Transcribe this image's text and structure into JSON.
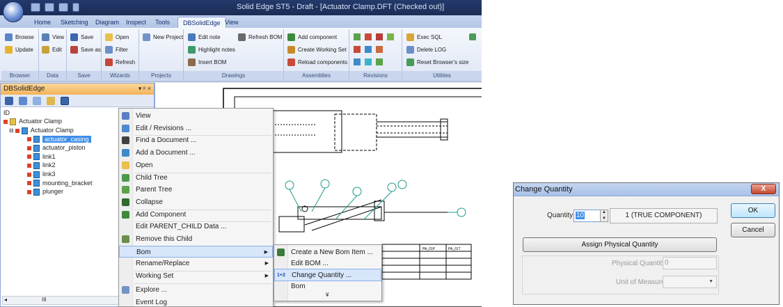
{
  "app": {
    "title": "Solid Edge ST5 - Draft - [Actuator Clamp.DFT (Checked out)]",
    "tabs": [
      "Home",
      "Sketching",
      "Diagram",
      "Inspect",
      "Tools",
      "DBSolidEdge",
      "View"
    ],
    "active_tab": "DBSolidEdge"
  },
  "ribbon": {
    "groups": {
      "browser": {
        "label": "Browser",
        "items": [
          "Browse",
          "Update"
        ]
      },
      "data": {
        "label": "Data",
        "items": [
          "View",
          "Edit"
        ]
      },
      "save": {
        "label": "Save",
        "items": [
          "Save",
          "Save as"
        ]
      },
      "wizards": {
        "label": "Wizards",
        "items": [
          "Open",
          "Filter",
          "Refresh"
        ]
      },
      "projects": {
        "label": "Projects",
        "items": [
          "New Project"
        ]
      },
      "drawings": {
        "label": "Drawings",
        "items": [
          "Edit note",
          "Highlight notes",
          "Insert BOM",
          "Refresh BOM"
        ]
      },
      "assemblies": {
        "label": "Assemblies",
        "items": [
          "Add component",
          "Create Working Set",
          "Reload components"
        ]
      },
      "revisions": {
        "label": "Revisions"
      },
      "utilities": {
        "label": "Utilities",
        "items": [
          "Exec SQL",
          "Delete LOG",
          "Reset Browser's size"
        ]
      }
    }
  },
  "panel": {
    "title": "DBSolidEdge",
    "controls": "▾ ᵖ ×",
    "column_header": "ID",
    "tree": {
      "root": "Actuator Clamp",
      "assembly": "Actuator Clamp",
      "children": [
        "actuator_casing",
        "actuator_piston",
        "link1",
        "link2",
        "link3",
        "mounting_bracket",
        "plunger"
      ],
      "selected": "actuator_casing"
    },
    "scroll_label": "III"
  },
  "context_menu": {
    "items": [
      "View",
      "Edit / Revisions ...",
      "Find a Document ...",
      "Add a Document ...",
      "Open",
      "Child Tree",
      "Parent Tree",
      "Collapse",
      "Add Component",
      "Edit PARENT_CHILD Data ...",
      "Remove this Child",
      "Bom",
      "Rename/Replace",
      "Working Set",
      "Explore ...",
      "Event Log"
    ],
    "highlighted": "Bom"
  },
  "submenu": {
    "items": [
      "Create a New Bom Item ...",
      "Edit BOM ...",
      "Change Quantity ...",
      "Bom"
    ],
    "highlighted": "Change Quantity ...",
    "more": "¥",
    "change_qty_icon": "1+2"
  },
  "drawing": {
    "table_headers": [
      "PA_01P",
      "PA_01T"
    ]
  },
  "dialog": {
    "title": "Change Quantity",
    "close_label": "X",
    "quantity_label": "Quantity",
    "quantity_value": "10",
    "component_text": "1 (TRUE COMPONENT)",
    "ok_label": "OK",
    "cancel_label": "Cancel",
    "assign_label": "Assign Physical Quantity",
    "physical_quantity_label": "Physical Quantity",
    "physical_quantity_value": "0",
    "unit_label": "Unit of Measure",
    "unit_value": ""
  }
}
